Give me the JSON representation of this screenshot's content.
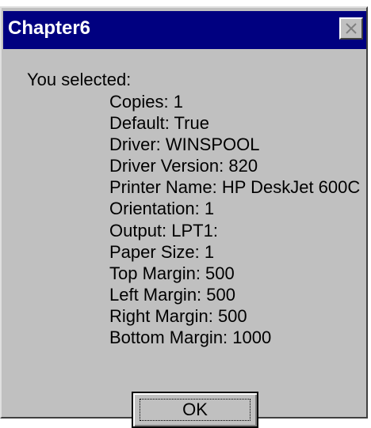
{
  "window": {
    "title": "Chapter6"
  },
  "message": {
    "heading": "You selected:",
    "lines": [
      "Copies: 1",
      "Default: True",
      "Driver: WINSPOOL",
      "Driver Version: 820",
      "Printer Name: HP DeskJet 600C",
      "Orientation: 1",
      "Output: LPT1:",
      "Paper Size: 1",
      "Top Margin: 500",
      "Left Margin: 500",
      "Right Margin: 500",
      "Bottom Margin: 1000"
    ]
  },
  "buttons": {
    "ok_label": "OK"
  },
  "icons": {
    "close": "close-icon"
  },
  "colors": {
    "titlebar": "#000080",
    "dialog_face": "#c0c0c0",
    "title_text": "#ffffff"
  }
}
